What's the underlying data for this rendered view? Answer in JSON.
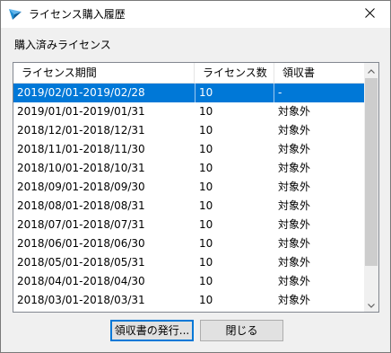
{
  "window": {
    "title": "ライセンス購入履歴"
  },
  "section_label": "購入済みライセンス",
  "table": {
    "columns": [
      "ライセンス期間",
      "ライセンス数",
      "領収書"
    ],
    "rows": [
      {
        "period": "2019/02/01-2019/02/28",
        "count": "10",
        "receipt": "-",
        "selected": true
      },
      {
        "period": "2019/01/01-2019/01/31",
        "count": "10",
        "receipt": "対象外"
      },
      {
        "period": "2018/12/01-2018/12/31",
        "count": "10",
        "receipt": "対象外"
      },
      {
        "period": "2018/11/01-2018/11/30",
        "count": "10",
        "receipt": "対象外"
      },
      {
        "period": "2018/10/01-2018/10/31",
        "count": "10",
        "receipt": "対象外"
      },
      {
        "period": "2018/09/01-2018/09/30",
        "count": "10",
        "receipt": "対象外"
      },
      {
        "period": "2018/08/01-2018/08/31",
        "count": "10",
        "receipt": "対象外"
      },
      {
        "period": "2018/07/01-2018/07/31",
        "count": "10",
        "receipt": "対象外"
      },
      {
        "period": "2018/06/01-2018/06/30",
        "count": "10",
        "receipt": "対象外"
      },
      {
        "period": "2018/05/01-2018/05/31",
        "count": "10",
        "receipt": "対象外"
      },
      {
        "period": "2018/04/01-2018/04/30",
        "count": "10",
        "receipt": "対象外"
      },
      {
        "period": "2018/03/01-2018/03/31",
        "count": "10",
        "receipt": "対象外"
      }
    ]
  },
  "buttons": {
    "issue_receipt": "領収書の発行...",
    "close": "閉じる"
  },
  "colors": {
    "selection": "#0078d7",
    "dialog_background": "#f0f0f0",
    "app_icon": "#1e8fd6"
  },
  "icons": {
    "app": "app-logo-icon",
    "close": "close-icon",
    "scroll_up": "chevron-up-icon",
    "scroll_down": "chevron-down-icon"
  }
}
